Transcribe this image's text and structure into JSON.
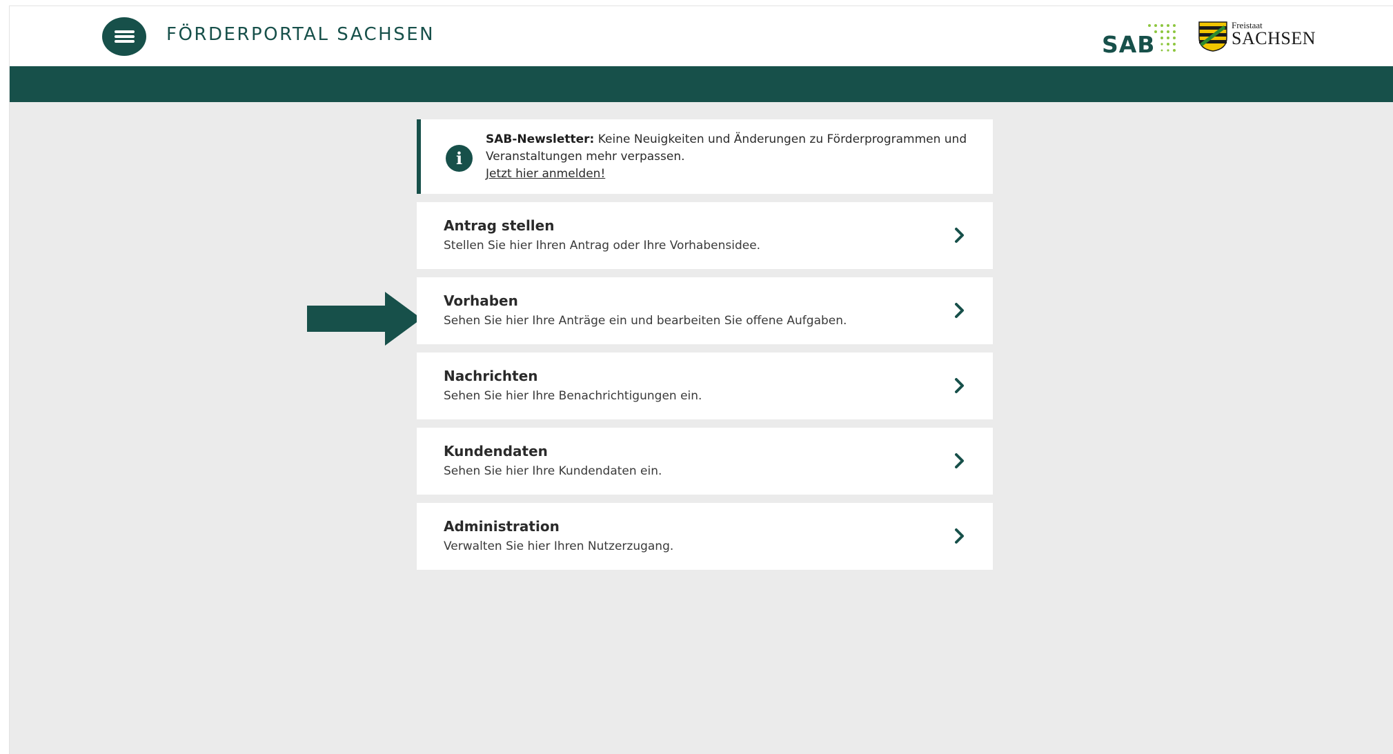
{
  "header": {
    "menu_icon": "hamburger-menu-icon",
    "title": "FÖRDERPORTAL SACHSEN",
    "sab_logo_text": "SAB",
    "sachsen_logo_small": "Freistaat",
    "sachsen_logo_large": "SACHSEN"
  },
  "newsletter": {
    "icon": "info-icon",
    "bold": "SAB-Newsletter:",
    "text": "Keine Neuigkeiten und Änderungen zu Förderprogrammen und Veranstaltungen mehr verpassen.",
    "link": "Jetzt hier anmelden!"
  },
  "cards": [
    {
      "title": "Antrag stellen",
      "desc": "Stellen Sie hier Ihren Antrag oder Ihre Vorhabensidee."
    },
    {
      "title": "Vorhaben",
      "desc": "Sehen Sie hier Ihre Anträge ein und bearbeiten Sie offene Aufgaben."
    },
    {
      "title": "Nachrichten",
      "desc": "Sehen Sie hier Ihre Benachrichtigungen ein."
    },
    {
      "title": "Kundendaten",
      "desc": "Sehen Sie hier Ihre Kundendaten ein."
    },
    {
      "title": "Administration",
      "desc": "Verwalten Sie hier Ihren Nutzerzugang."
    }
  ],
  "colors": {
    "primary": "#17504a",
    "background": "#ebebeb",
    "sab_dots": "#8dc63f"
  }
}
